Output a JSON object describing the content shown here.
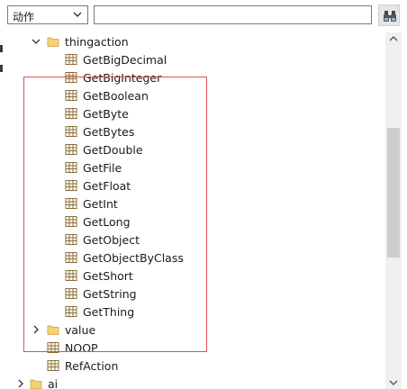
{
  "toolbar": {
    "category_select_value": "动作",
    "search_value": "",
    "search_placeholder": ""
  },
  "tree": {
    "parent": {
      "label": "thingaction",
      "expanded": true
    },
    "children": [
      "GetBigDecimal",
      "GetBigInteger",
      "GetBoolean",
      "GetByte",
      "GetBytes",
      "GetDouble",
      "GetFile",
      "GetFloat",
      "GetInt",
      "GetLong",
      "GetObject",
      "GetObjectByClass",
      "GetShort",
      "GetString",
      "GetThing"
    ],
    "siblings": [
      {
        "label": "value",
        "kind": "folder",
        "expanded": false
      },
      {
        "label": "NOOP",
        "kind": "item"
      },
      {
        "label": "RefAction",
        "kind": "item"
      }
    ],
    "bottom_folder": {
      "label": "ai",
      "expanded": false
    }
  },
  "colors": {
    "highlight_box": "#e05050",
    "folder": "#e8c15a",
    "item_icon": "#8a6d3b"
  },
  "icons": {
    "folder": "folder-icon",
    "item": "table-icon",
    "expand": "chevron-right-icon",
    "collapse": "chevron-down-icon",
    "find": "binoculars-icon"
  }
}
